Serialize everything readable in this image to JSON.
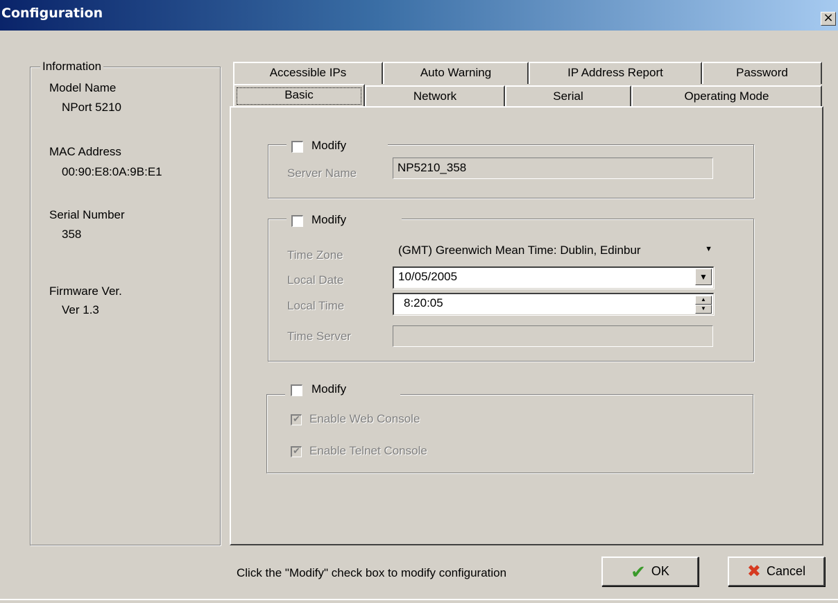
{
  "window": {
    "title": "Configuration",
    "close_glyph": "×"
  },
  "information": {
    "legend": "Information",
    "model_name_label": "Model Name",
    "model_name_value": "NPort 5210",
    "mac_label": "MAC Address",
    "mac_value": "00:90:E8:0A:9B:E1",
    "serial_label": "Serial Number",
    "serial_value": "358",
    "firmware_label": "Firmware Ver.",
    "firmware_value": "Ver 1.3"
  },
  "tabs": {
    "row1": [
      "Accessible IPs",
      "Auto Warning",
      "IP Address Report",
      "Password"
    ],
    "row2": [
      "Basic",
      "Network",
      "Serial",
      "Operating Mode"
    ],
    "active": "Basic"
  },
  "server_group": {
    "modify_label": "Modify",
    "server_name_label": "Server Name",
    "server_name_value": "NP5210_358"
  },
  "time_group": {
    "modify_label": "Modify",
    "time_zone_label": "Time Zone",
    "time_zone_value": "(GMT) Greenwich Mean Time: Dublin, Edinbur",
    "local_date_label": "Local Date",
    "local_date_value": "10/05/2005",
    "local_time_label": "Local Time",
    "local_time_value": "8:20:05",
    "time_server_label": "Time Server",
    "time_server_value": ""
  },
  "console_group": {
    "modify_label": "Modify",
    "web_console_label": "Enable Web Console",
    "web_console_checked": true,
    "telnet_console_label": "Enable Telnet Console",
    "telnet_console_checked": true
  },
  "footer": {
    "hint": "Click the \"Modify\" check box to modify configuration",
    "ok_label": "OK",
    "cancel_label": "Cancel"
  },
  "icons": {
    "ok": "check-icon",
    "cancel": "x-icon",
    "dropdown": "chevron-down-icon",
    "spin_up": "arrow-up-icon",
    "spin_down": "arrow-down-icon"
  },
  "colors": {
    "titlebar_start": "#0a246a",
    "titlebar_end": "#a6caf0",
    "dialog_bg": "#d4d0c8",
    "ok_icon": "#3a9a2a",
    "cancel_icon": "#d63a20"
  }
}
